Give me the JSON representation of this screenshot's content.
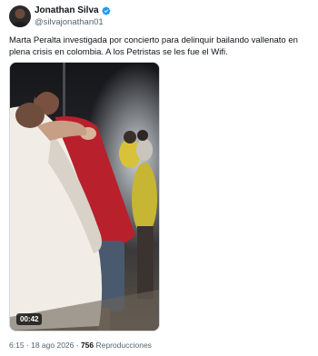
{
  "author": {
    "name": "Jonathan Silva",
    "handle": "@silvajonathan01",
    "verified_color": "#1d9bf0"
  },
  "tweet": {
    "text": "Marta Peralta investigada por concierto para delinquir bailando vallenato en plena crisis en colombia. A los Petristas se les fue el Wifi."
  },
  "media": {
    "type": "video",
    "duration": "00:42"
  },
  "meta": {
    "time": "6:15",
    "separator1": " · ",
    "date": "18 ago 2026",
    "separator2": " · ",
    "views": "756",
    "views_label": " Reproducciones"
  }
}
